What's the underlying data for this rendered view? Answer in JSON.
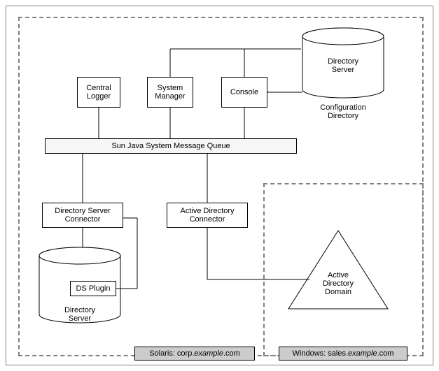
{
  "nodes": {
    "central_logger": "Central\nLogger",
    "system_manager": "System\nManager",
    "console": "Console",
    "dir_server_top": "Directory\nServer",
    "config_dir": "Configuration\nDirectory",
    "queue": "Sun Java System Message Queue",
    "ds_connector": "Directory Server\nConnector",
    "ad_connector": "Active Directory\nConnector",
    "ds_plugin": "DS Plugin",
    "dir_server_bottom": "Directory\nServer",
    "ad_domain": "Active\nDirectory\nDomain"
  },
  "footers": {
    "solaris_prefix": "Solaris: corp.",
    "solaris_mid": "example",
    "solaris_suffix": ".com",
    "windows_prefix": "Windows: sales.",
    "windows_mid": "example",
    "windows_suffix": ".com"
  }
}
